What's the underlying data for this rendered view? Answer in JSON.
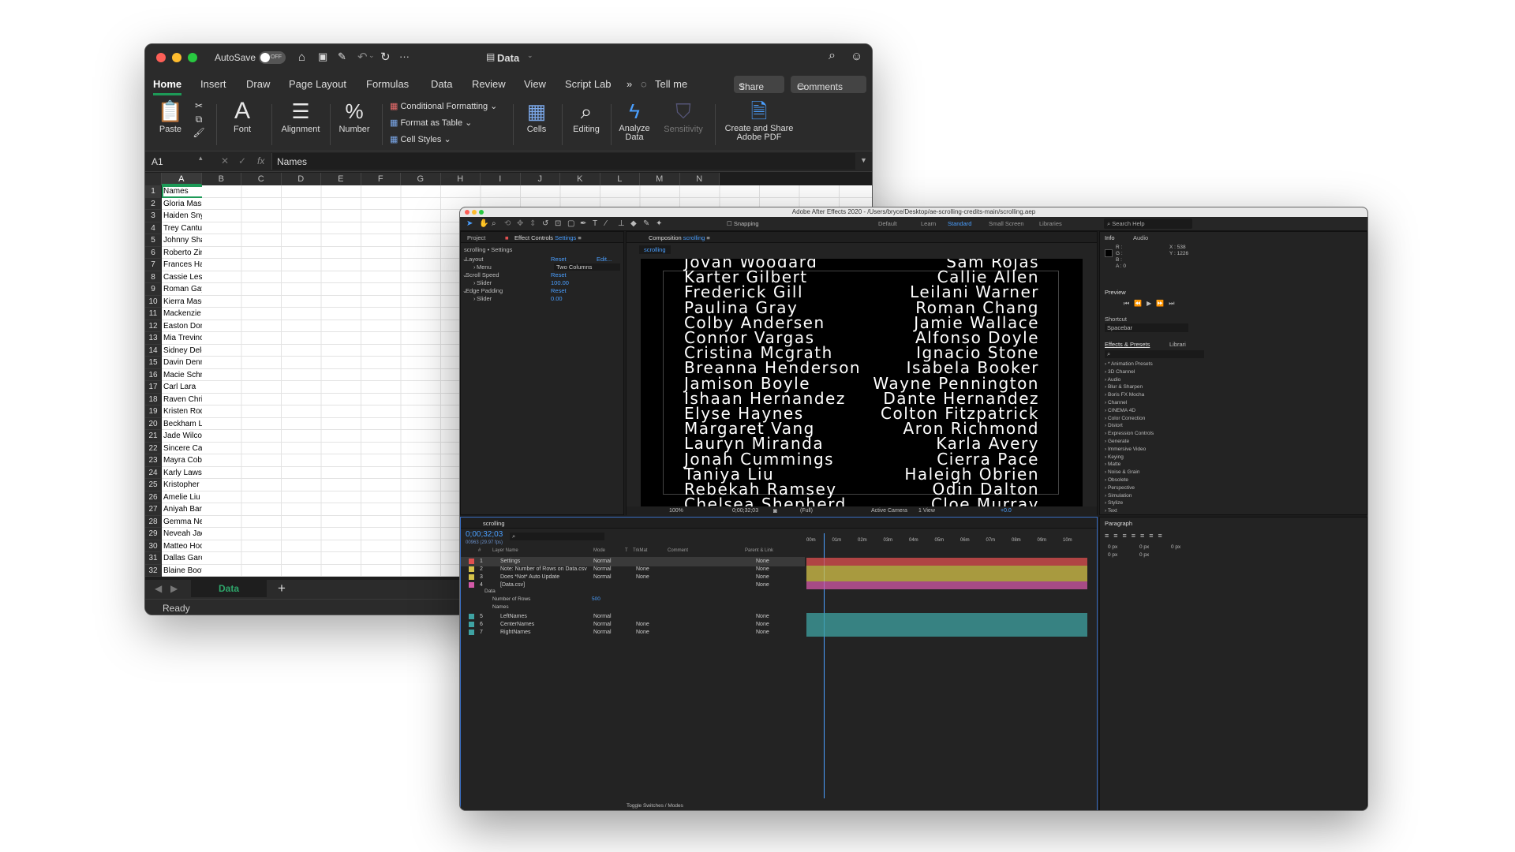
{
  "excel": {
    "autosave": "AutoSave",
    "autosave_state": "OFF",
    "doc_title": "Data",
    "tabs": [
      "Home",
      "Insert",
      "Draw",
      "Page Layout",
      "Formulas",
      "Data",
      "Review",
      "View",
      "Script Lab"
    ],
    "tell_me": "Tell me",
    "share": "Share",
    "comments": "Comments",
    "ribbon": {
      "paste": "Paste",
      "font": "Font",
      "alignment": "Alignment",
      "number": "Number",
      "conditional_formatting": "Conditional Formatting",
      "format_as_table": "Format as Table",
      "cell_styles": "Cell Styles",
      "cells": "Cells",
      "editing": "Editing",
      "analyze_data_1": "Analyze",
      "analyze_data_2": "Data",
      "sensitivity": "Sensitivity",
      "adobe_pdf_1": "Create and Share",
      "adobe_pdf_2": "Adobe PDF"
    },
    "name_box": "A1",
    "fx": "fx",
    "formula": "Names",
    "columns": [
      "A",
      "B",
      "C",
      "D",
      "E",
      "F",
      "G",
      "H",
      "I",
      "J",
      "K",
      "L",
      "M",
      "N"
    ],
    "rows": [
      "Names",
      "Gloria Massey",
      "Haiden Snyder",
      "Trey Cantu",
      "Johnny Sharp",
      "Roberto Zimmerman",
      "Frances Hardin",
      "Cassie Lester",
      "Roman Gay",
      "Kierra Mason",
      "Mackenzie Padilla",
      "Easton Dominguez",
      "Mia Trevino",
      "Sidney Deleon",
      "Davin Dennis",
      "Macie Schneider",
      "Carl Lara",
      "Raven Christensen",
      "Kristen Rodgers",
      "Beckham Leach",
      "Jade Wilcox",
      "Sincere Cannon",
      "Mayra Cobb",
      "Karly Lawson",
      "Kristopher Lambert",
      "Amelie Liu",
      "Aniyah Barton",
      "Gemma Neal",
      "Neveah Jacobson",
      "Matteo Hood",
      "Dallas Garcia",
      "Blaine Booth"
    ],
    "sheet_tab": "Data",
    "status": "Ready"
  },
  "ae": {
    "title": "Adobe After Effects 2020 - /Users/bryce/Desktop/ae-scrolling-credits-main/scrolling.aep",
    "snapping": "Snapping",
    "workspaces": [
      "Default",
      "Learn",
      "Standard",
      "Small Screen",
      "Libraries"
    ],
    "search_help": "Search Help",
    "project_tab": "Project",
    "effect_controls_tab": "Effect Controls",
    "effect_controls_target": "Settings",
    "ec_path": "scrolling • Settings",
    "effects": [
      {
        "name": "Layout",
        "value": "Reset",
        "extra": "Edit..."
      },
      {
        "name": "Menu",
        "value": "Two Columns",
        "extra": ""
      },
      {
        "name": "Scroll Speed",
        "value": "Reset",
        "extra": ""
      },
      {
        "name": "Slider",
        "value": "100.00",
        "extra": ""
      },
      {
        "name": "Edge Padding",
        "value": "Reset",
        "extra": ""
      },
      {
        "name": "Slider",
        "value": "0.00",
        "extra": ""
      }
    ],
    "comp_tab": "Composition",
    "comp_name": "scrolling",
    "comp_sub_tab": "scrolling",
    "credits_left": [
      "Jovan Woodard",
      "Karter Gilbert",
      "Frederick Gill",
      "Paulina Gray",
      "Colby Andersen",
      "Connor Vargas",
      "Cristina Mcgrath",
      "Breanna Henderson",
      "Jamison Boyle",
      "Ishaan Hernandez",
      "Elyse Haynes",
      "Margaret Vang",
      "Lauryn Miranda",
      "Jonah Cummings",
      "Taniya Liu",
      "Rebekah Ramsey",
      "Chelsea Shepherd"
    ],
    "credits_right": [
      "Sam Rojas",
      "Callie Allen",
      "Leilani Warner",
      "Roman Chang",
      "Jamie Wallace",
      "Alfonso Doyle",
      "Ignacio Stone",
      "Isabela Booker",
      "Wayne Pennington",
      "Dante Hernandez",
      "Colton Fitzpatrick",
      "Aron Richmond",
      "Karla Avery",
      "Cierra Pace",
      "Haleigh Obrien",
      "Odin Dalton",
      "Cloe Murray"
    ],
    "viewer_footer": {
      "zoom": "100%",
      "timecode": "0;00;32;03",
      "resolution": "(Full)",
      "camera": "Active Camera",
      "views": "1 View",
      "exposure": "+0.0"
    },
    "info": {
      "tab": "Info",
      "audio": "Audio",
      "r": "R :",
      "g": "G :",
      "b": "B :",
      "a": "A : 0",
      "x": "X : 538",
      "y": "Y : 1226"
    },
    "preview": "Preview",
    "shortcut_label": "Shortcut",
    "shortcut_value": "Spacebar",
    "effects_presets": "Effects & Presets",
    "libraries": "Librari",
    "effect_categories": [
      "* Animation Presets",
      "3D Channel",
      "Audio",
      "Blur & Sharpen",
      "Boris FX Mocha",
      "Channel",
      "CINEMA 4D",
      "Color Correction",
      "Distort",
      "Expression Controls",
      "Generate",
      "Immersive Video",
      "Keying",
      "Matte",
      "Noise & Grain",
      "Obsolete",
      "Perspective",
      "Simulation",
      "Stylize",
      "Text"
    ],
    "timeline": {
      "tab": "scrolling",
      "timecode": "0;00;32;03",
      "frames": "00963 (29.97 fps)",
      "headers": {
        "num": "#",
        "layer_name": "Layer Name",
        "mode": "Mode",
        "t": "T",
        "trkmat": "TrkMat",
        "comment": "Comment",
        "parent": "Parent & Link"
      },
      "layers": [
        {
          "num": "1",
          "name": "Settings",
          "mode": "Normal",
          "trkmat": "",
          "parent": "None",
          "color": "#e05050"
        },
        {
          "num": "2",
          "name": "Note: Number of Rows on Data.csv",
          "mode": "Normal",
          "trkmat": "None",
          "parent": "None",
          "color": "#d6c34a"
        },
        {
          "num": "3",
          "name": "Does *Not* Auto Update",
          "mode": "Normal",
          "trkmat": "None",
          "parent": "None",
          "color": "#d6c34a"
        },
        {
          "num": "4",
          "name": "[Data.csv]",
          "mode": "",
          "trkmat": "",
          "parent": "None",
          "color": "#d45aa8"
        },
        {
          "num": "5",
          "name": "LeftNames",
          "mode": "Normal",
          "trkmat": "",
          "parent": "None",
          "color": "#3fa3a3"
        },
        {
          "num": "6",
          "name": "CenterNames",
          "mode": "Normal",
          "trkmat": "None",
          "parent": "None",
          "color": "#3fa3a3"
        },
        {
          "num": "7",
          "name": "RightNames",
          "mode": "Normal",
          "trkmat": "None",
          "parent": "None",
          "color": "#3fa3a3"
        }
      ],
      "sub_data": "Data",
      "sub_rows_label": "Number of Rows",
      "sub_rows_value": "500",
      "sub_names": "Names",
      "ruler": [
        "00m",
        "01m",
        "02m",
        "03m",
        "04m",
        "05m",
        "06m",
        "07m",
        "08m",
        "09m",
        "10m"
      ],
      "toggle": "Toggle Switches / Modes"
    },
    "paragraph": {
      "tab": "Paragraph",
      "values": [
        "0 px",
        "0 px",
        "0 px",
        "0 px",
        "0 px"
      ]
    }
  }
}
